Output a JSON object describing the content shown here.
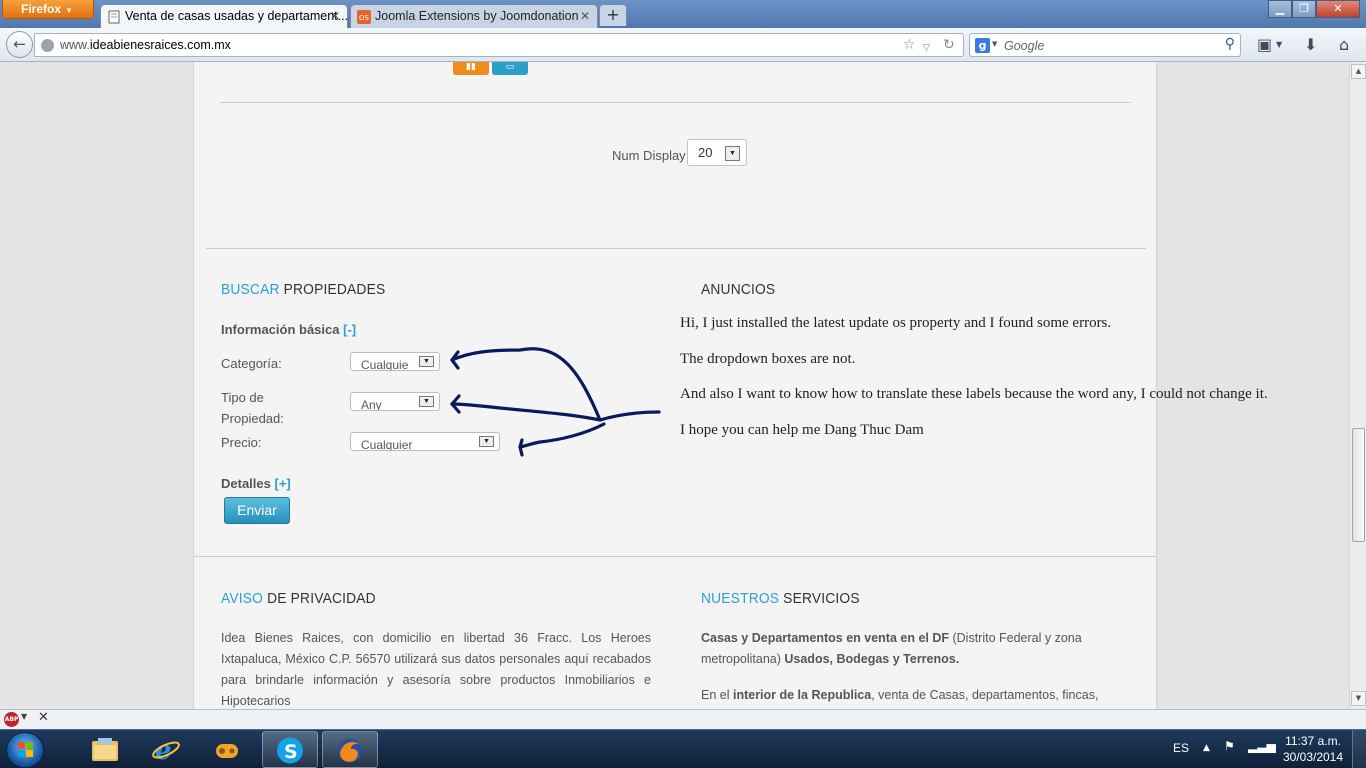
{
  "browser": {
    "menu_button": "Firefox",
    "tabs": [
      {
        "title": "Venta de casas usadas y departament...",
        "active": true
      },
      {
        "title": "Joomla Extensions by Joomdonation",
        "active": false
      }
    ],
    "url_domain": "ideabienesraices.com.mx",
    "url_prefix": "www.",
    "search_placeholder": "Google",
    "search_engine_icon": "g-icon"
  },
  "page": {
    "num_display": {
      "label": "Num Display",
      "value": "20"
    },
    "search_section": {
      "title_accent": "BUSCAR",
      "title_rest": " PROPIEDADES",
      "basic_info_label": "Información básica",
      "basic_info_toggle": "[-]",
      "fields": [
        {
          "label": "Categoría:",
          "value": "Cualquie"
        },
        {
          "label_line1": "Tipo de",
          "label_line2": "Propiedad:",
          "value": "Any"
        },
        {
          "label": "Precio:",
          "value": "Cualquier"
        }
      ],
      "details_label": "Detalles",
      "details_toggle": "[+]",
      "submit_label": "Enviar"
    },
    "ads_section": {
      "title": "ANUNCIOS",
      "notes": [
        "Hi, I just installed the latest update os property and I found some errors.",
        "The dropdown boxes are not.",
        "And also I want to know how to translate these labels because the word any, I could not change it.",
        "I hope you can help me Dang Thuc Dam"
      ]
    },
    "privacy_section": {
      "title_accent": "AVISO",
      "title_rest": " DE PRIVACIDAD",
      "text": "Idea Bienes Raices, con domicilio en libertad 36 Fracc. Los Heroes Ixtapaluca, México C.P. 56570 utilizará sus datos personales aquí recabados para brindarle información y asesoría sobre productos Inmobiliarios e Hipotecarios"
    },
    "services_section": {
      "title_accent": "NUESTROS",
      "title_rest": " SERVICIOS",
      "p1_bold1": "Casas y Departamentos en venta en el DF",
      "p1_text1": " (Distrito Federal y zona metropolitana) ",
      "p1_bold2": "Usados, Bodegas y Terrenos.",
      "p2_text1": "En el ",
      "p2_bold1": "interior de la Republica",
      "p2_text2": ", venta de Casas, departamentos, fincas,"
    }
  },
  "taskbar": {
    "language": "ES",
    "time": "11:37 a.m.",
    "date": "30/03/2014",
    "apps": [
      "explorer-icon",
      "internet-explorer-icon",
      "games-icon",
      "skype-icon",
      "firefox-icon"
    ]
  },
  "colors": {
    "accent": "#2a9fd0",
    "button": "#2690bd",
    "annotation_ink": "#0a1a5c"
  }
}
